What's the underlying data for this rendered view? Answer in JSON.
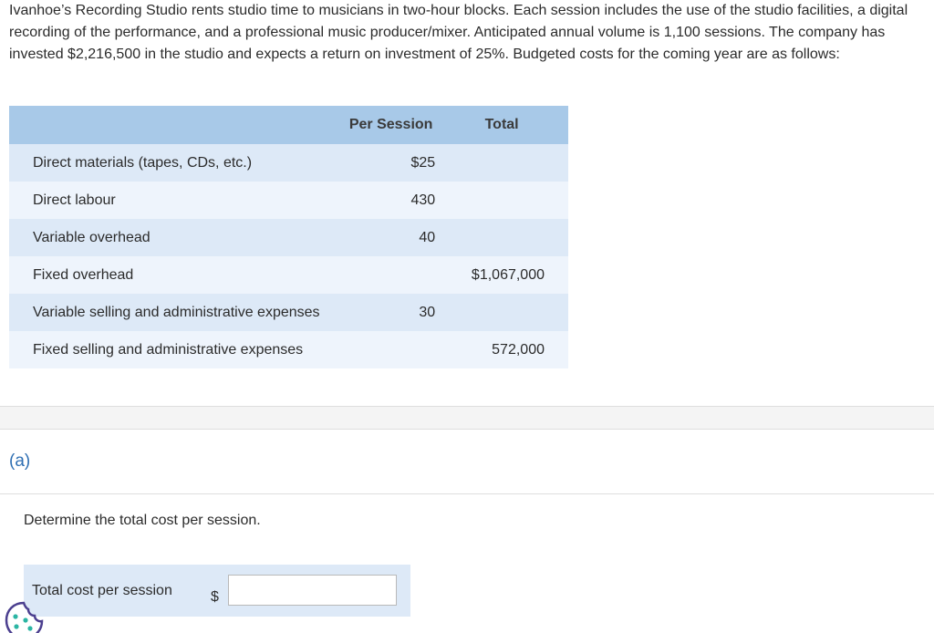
{
  "intro": {
    "text": "Ivanhoe’s Recording Studio rents studio time to musicians in two-hour blocks. Each session includes the use of the studio facilities, a digital recording of the performance, and a professional music producer/mixer. Anticipated annual volume is 1,100 sessions. The company has invested $2,216,500 in the studio and expects a return on investment of 25%. Budgeted costs for the coming year are as follows:"
  },
  "table": {
    "headers": {
      "label": "",
      "per_session": "Per Session",
      "total": "Total"
    },
    "rows": [
      {
        "label": "Direct materials (tapes, CDs, etc.)",
        "per_session": "$25",
        "total": ""
      },
      {
        "label": "Direct labour",
        "per_session": "430",
        "total": ""
      },
      {
        "label": "Variable overhead",
        "per_session": "40",
        "total": ""
      },
      {
        "label": "Fixed overhead",
        "per_session": "",
        "total": "$1,067,000"
      },
      {
        "label": "Variable selling and administrative expenses",
        "per_session": "30",
        "total": ""
      },
      {
        "label": "Fixed selling and administrative expenses",
        "per_session": "",
        "total": "572,000"
      }
    ]
  },
  "part": {
    "label": "(a)",
    "question": "Determine the total cost per session.",
    "answer_label": "Total cost per session",
    "currency": "$",
    "answer_value": "",
    "answer_placeholder": ""
  },
  "icons": {
    "help": "cookie-icon"
  }
}
